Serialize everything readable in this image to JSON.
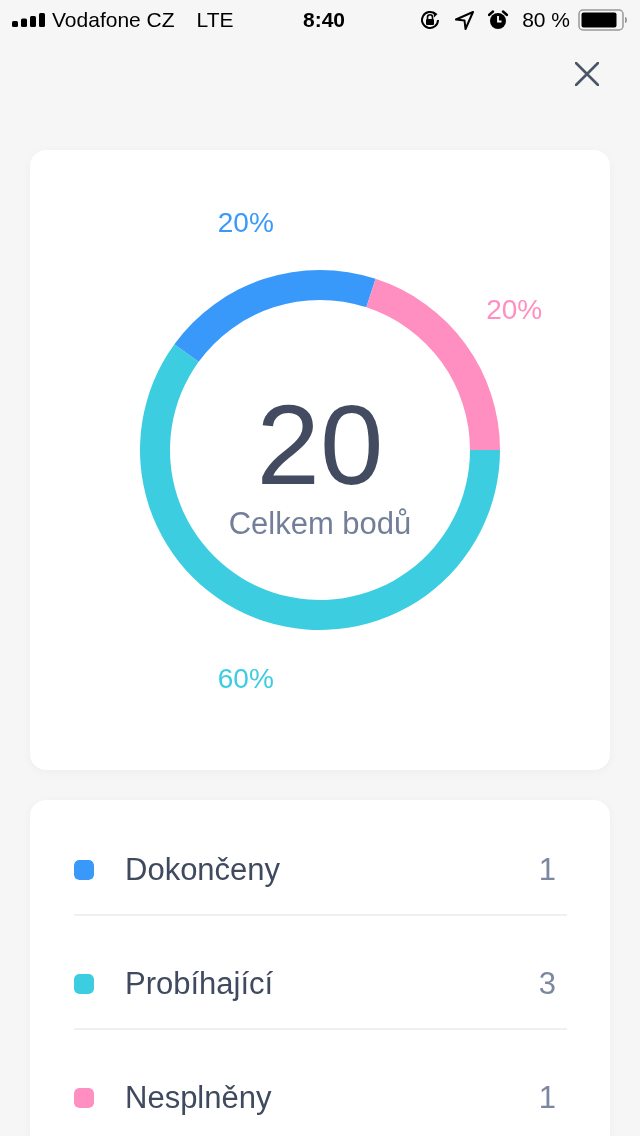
{
  "status_bar": {
    "carrier": "Vodafone CZ",
    "network": "LTE",
    "time": "8:40",
    "battery": "80 %"
  },
  "summary_card": {
    "total": "20",
    "total_label": "Celkem bodů",
    "chart_data": {
      "type": "donut",
      "values": [
        60,
        20,
        20
      ],
      "colors": [
        "#3dcde0",
        "#3899fb",
        "#ff8fc0"
      ],
      "value_labels": [
        "60%",
        "20%",
        "20%"
      ]
    }
  },
  "legend": {
    "items": [
      {
        "label": "Dokončeny",
        "count": "1",
        "color": "#3899fb"
      },
      {
        "label": "Probíhající",
        "count": "3",
        "color": "#3dcde0"
      },
      {
        "label": "Nesplněny",
        "count": "1",
        "color": "#ff8fc0"
      }
    ]
  }
}
